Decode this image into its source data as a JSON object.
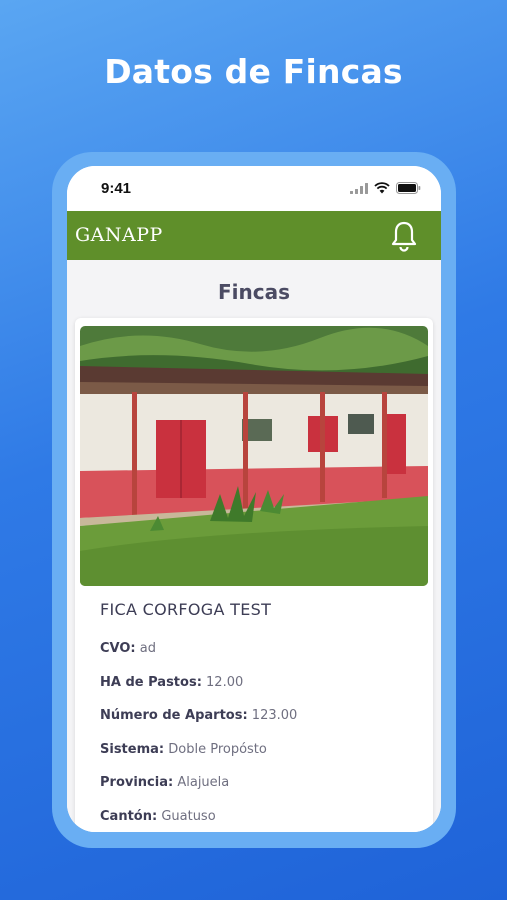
{
  "headline": "Datos de Fincas",
  "status_bar": {
    "time": "9:41"
  },
  "app_bar": {
    "title": "GANAPP",
    "icons": [
      "bell-icon"
    ]
  },
  "page": {
    "title": "Fincas"
  },
  "farm_card": {
    "name": "FICA CORFOGA TEST",
    "details": [
      {
        "label": "CVO:",
        "value": "ad"
      },
      {
        "label": "HA de Pastos:",
        "value": "12.00"
      },
      {
        "label": "Número de Apartos:",
        "value": "123.00"
      },
      {
        "label": "Sistema:",
        "value": "Doble Propósto"
      },
      {
        "label": "Provincia:",
        "value": "Alajuela"
      },
      {
        "label": "Cantón:",
        "value": "Guatuso"
      }
    ]
  },
  "colors": {
    "app_bar": "#5f8f2a",
    "background_gradient_start": "#5aa6f2",
    "background_gradient_end": "#1f63d8",
    "title_text": "#4b4b63"
  }
}
